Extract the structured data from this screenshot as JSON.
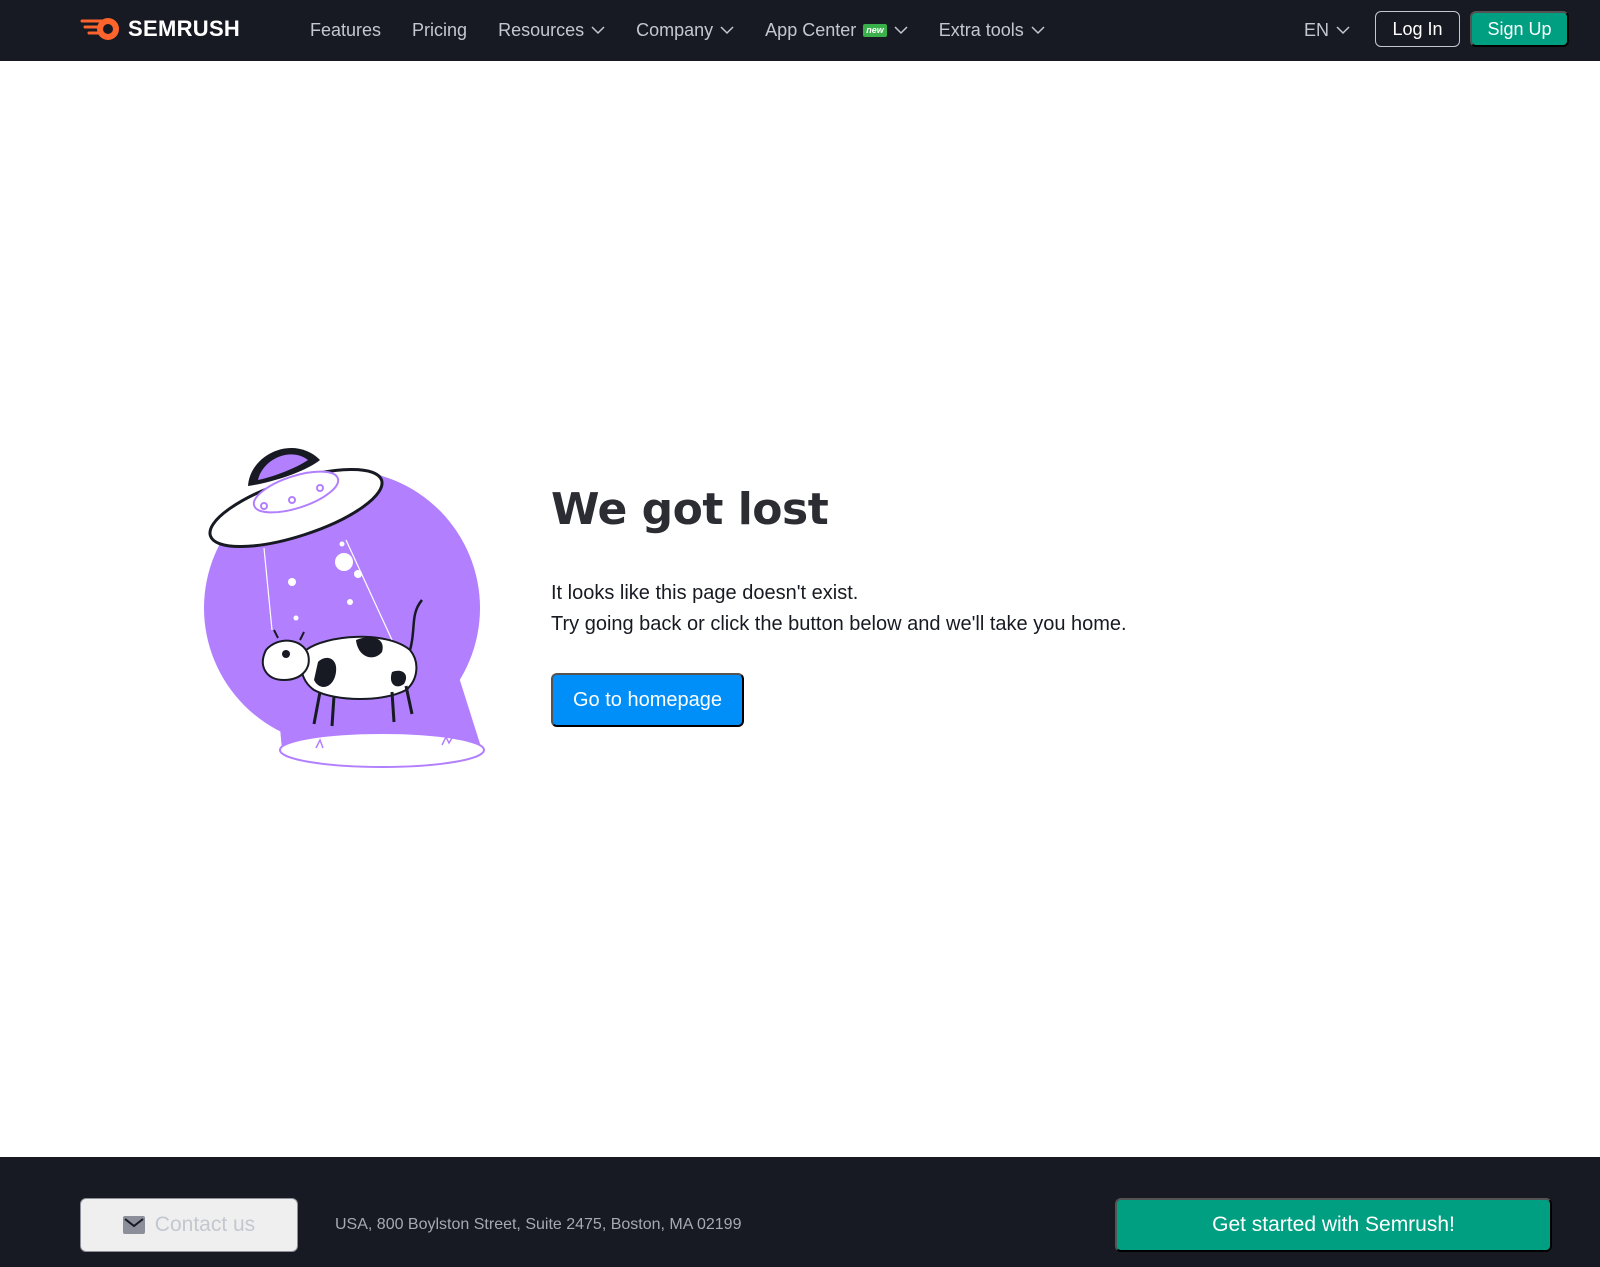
{
  "header": {
    "logo_text": "SEMRUSH",
    "nav": [
      {
        "label": "Features",
        "dropdown": false
      },
      {
        "label": "Pricing",
        "dropdown": false
      },
      {
        "label": "Resources",
        "dropdown": true
      },
      {
        "label": "Company",
        "dropdown": true
      },
      {
        "label": "App Center",
        "dropdown": true,
        "badge": "new"
      },
      {
        "label": "Extra tools",
        "dropdown": true
      }
    ],
    "language": "EN",
    "login_label": "Log In",
    "signup_label": "Sign Up"
  },
  "main": {
    "title": "We got lost",
    "line1": "It looks like this page doesn't exist.",
    "line2": "Try going back or click the button below and we'll take you home.",
    "button_label": "Go to homepage"
  },
  "footer": {
    "contact_label": "Contact us",
    "address": "USA, 800 Boylston Street, Suite 2475, Boston, MA 02199",
    "cta_label": "Get started with Semrush!"
  },
  "colors": {
    "header_bg": "#171a22",
    "brand_orange": "#ff642d",
    "signup_green": "#009f81",
    "primary_blue": "#008ff8",
    "illustration_purple": "#b27fff",
    "new_badge_green": "#3ab04a"
  },
  "icons": [
    "semrush-logo-icon",
    "chevron-down-icon",
    "mail-icon",
    "ufo-cow-illustration"
  ]
}
